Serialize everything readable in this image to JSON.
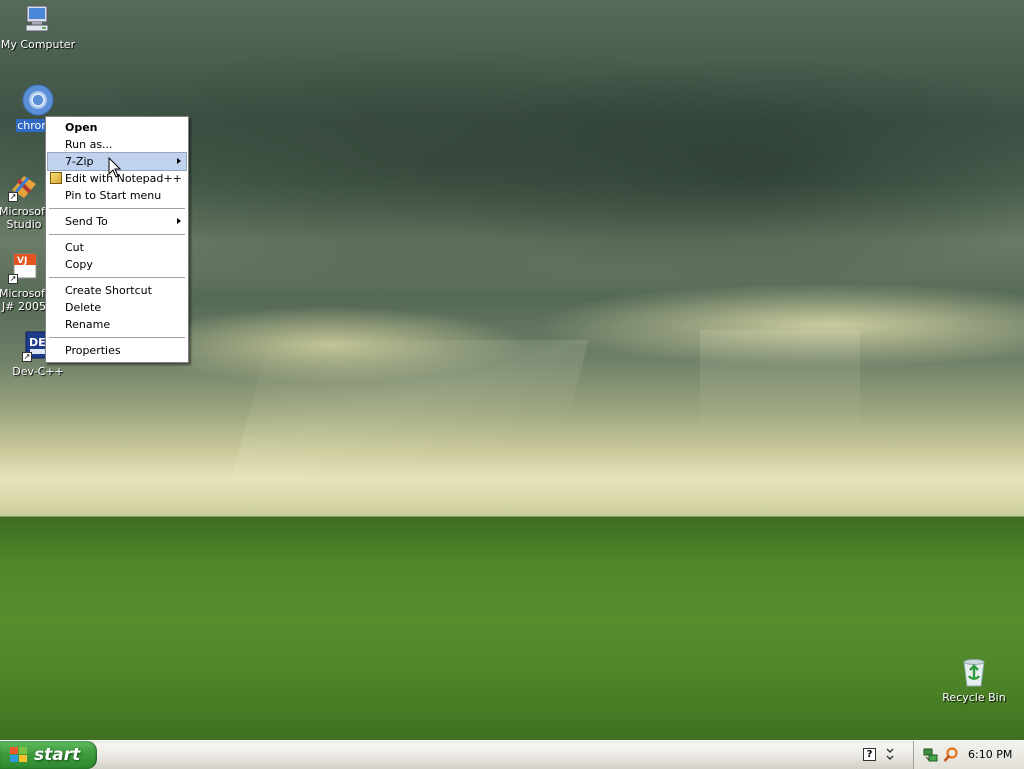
{
  "desktop": {
    "icons": [
      {
        "label": "My Computer",
        "icon": "my-computer-icon"
      },
      {
        "label": "chrome",
        "icon": "chrome-icon",
        "selected": true
      },
      {
        "label": "Microsoft Studio",
        "icon": "visual-studio-icon",
        "line1": "Microsoft",
        "line2": "Studio"
      },
      {
        "label": "Microsoft J# 2005",
        "icon": "vjsharp-icon",
        "line1": "Microsoft",
        "line2": "J# 2005"
      },
      {
        "label": "Dev-C++",
        "icon": "devcpp-icon"
      },
      {
        "label": "Recycle Bin",
        "icon": "recycle-bin-icon"
      }
    ]
  },
  "context_menu": {
    "groups": [
      [
        {
          "label": "Open",
          "bold": true
        },
        {
          "label": "Run as..."
        },
        {
          "label": "7-Zip",
          "submenu": true,
          "highlighted": true
        },
        {
          "label": "Edit with Notepad++",
          "icon": "notepadpp-icon"
        },
        {
          "label": "Pin to Start menu"
        }
      ],
      [
        {
          "label": "Send To",
          "submenu": true
        }
      ],
      [
        {
          "label": "Cut"
        },
        {
          "label": "Copy"
        }
      ],
      [
        {
          "label": "Create Shortcut"
        },
        {
          "label": "Delete"
        },
        {
          "label": "Rename"
        }
      ],
      [
        {
          "label": "Properties"
        }
      ]
    ]
  },
  "taskbar": {
    "start_label": "start",
    "help_glyph": "?",
    "clock": "6:10 PM",
    "tray_icons": [
      "network-icon",
      "search-icon"
    ]
  },
  "colors": {
    "selection": "#316ac5",
    "menu_highlight": "#c1d2ee",
    "start_green": "#3d9a3d"
  }
}
